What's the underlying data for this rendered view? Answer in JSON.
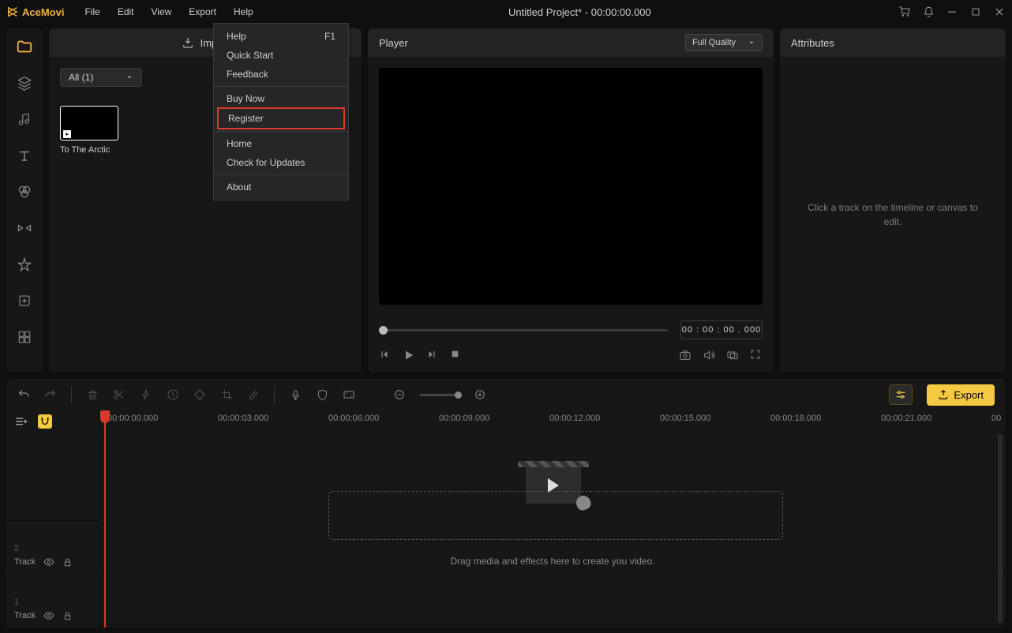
{
  "app": {
    "name": "AceMovi",
    "title": "Untitled Project* - 00:00:00.000"
  },
  "menubar": {
    "file": "File",
    "edit": "Edit",
    "view": "View",
    "export": "Export",
    "help": "Help"
  },
  "help_menu": {
    "help": "Help",
    "help_shortcut": "F1",
    "quick_start": "Quick Start",
    "feedback": "Feedback",
    "buy_now": "Buy Now",
    "register": "Register",
    "home": "Home",
    "check_updates": "Check for Updates",
    "about": "About"
  },
  "media": {
    "import": "Import",
    "filter": "All (1)",
    "clip_name": "To The Arctic"
  },
  "player": {
    "title": "Player",
    "quality": "Full Quality",
    "time": "00 : 00 : 00 . 000"
  },
  "attributes": {
    "title": "Attributes",
    "hint": "Click a track on the timeline or canvas to edit."
  },
  "toolbar": {
    "export": "Export"
  },
  "timeline": {
    "labels": [
      "00:00:00.000",
      "00:00:03.000",
      "00:00:06.000",
      "00:00:09.000",
      "00:00:12.000",
      "00:00:15.000",
      "00:00:18.000",
      "00:00:21.000",
      "00"
    ],
    "track2_num": "2",
    "track2_name": "Track",
    "track1_num": "1",
    "track1_name": "Track",
    "drop_hint": "Drag media and effects here to create you video."
  }
}
